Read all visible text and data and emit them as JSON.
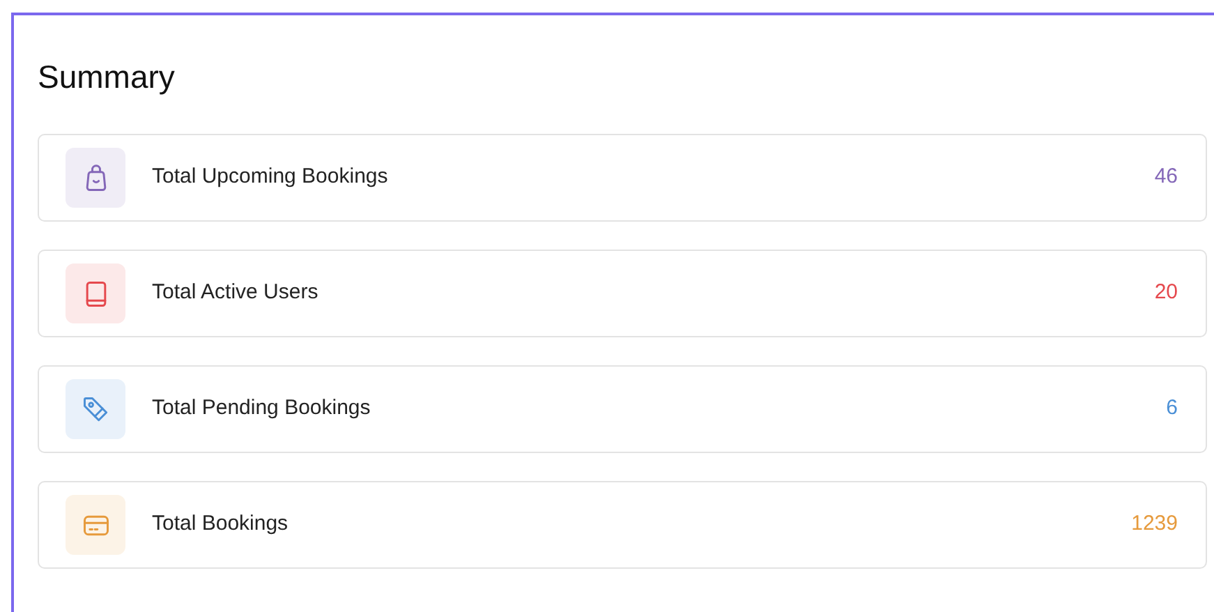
{
  "title": "Summary",
  "stats": [
    {
      "kind": "bag",
      "label": "Total Upcoming Bookings",
      "value": "46",
      "color": "#8467b8"
    },
    {
      "kind": "book",
      "label": "Total Active Users",
      "value": "20",
      "color": "#e5484d"
    },
    {
      "kind": "tag",
      "label": "Total Pending Bookings",
      "value": "6",
      "color": "#4a8fd6"
    },
    {
      "kind": "card",
      "label": "Total Bookings",
      "value": "1239",
      "color": "#e69a3c"
    }
  ]
}
